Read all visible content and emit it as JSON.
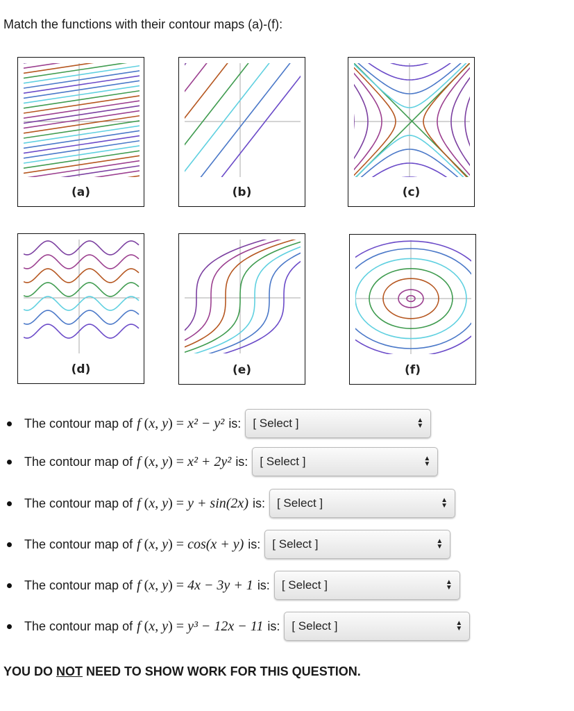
{
  "title": "Match the functions with their contour maps (a)-(f):",
  "panels": [
    {
      "id": "a",
      "label": "(a)",
      "kind": "diagonal-lines-negative-slope"
    },
    {
      "id": "b",
      "label": "(b)",
      "kind": "parallel-lines-positive-slope"
    },
    {
      "id": "c",
      "label": "(c)",
      "kind": "hyperbolas"
    },
    {
      "id": "d",
      "label": "(d)",
      "kind": "sine-waves"
    },
    {
      "id": "e",
      "label": "(e)",
      "kind": "cubic-curves"
    },
    {
      "id": "f",
      "label": "(f)",
      "kind": "ellipses"
    }
  ],
  "contour_colors": [
    "#7b3fa0",
    "#9b3f8f",
    "#b5561f",
    "#3f9b4f",
    "#5fd0e0",
    "#4a78c8",
    "#6a4ac8"
  ],
  "questions": [
    {
      "prefix": "The contour map of",
      "func": "x² − y²",
      "suffix": "is:",
      "selected": "[ Select ]"
    },
    {
      "prefix": "The contour map of",
      "func": "x² + 2y²",
      "suffix": "is:",
      "selected": "[ Select ]"
    },
    {
      "prefix": "The contour map of",
      "func": "y + sin(2x)",
      "suffix": "is:",
      "selected": "[ Select ]"
    },
    {
      "prefix": "The contour map of",
      "func": "cos(x + y)",
      "suffix": "is:",
      "selected": "[ Select ]"
    },
    {
      "prefix": "The contour map of",
      "func": "4x − 3y + 1",
      "suffix": "is:",
      "selected": "[ Select ]"
    },
    {
      "prefix": "The contour map of",
      "func": "y³ − 12x − 11",
      "suffix": "is:",
      "selected": "[ Select ]"
    }
  ],
  "footer": {
    "before": "YOU DO ",
    "emph": "NOT",
    "after": " NEED TO SHOW WORK FOR THIS QUESTION."
  }
}
